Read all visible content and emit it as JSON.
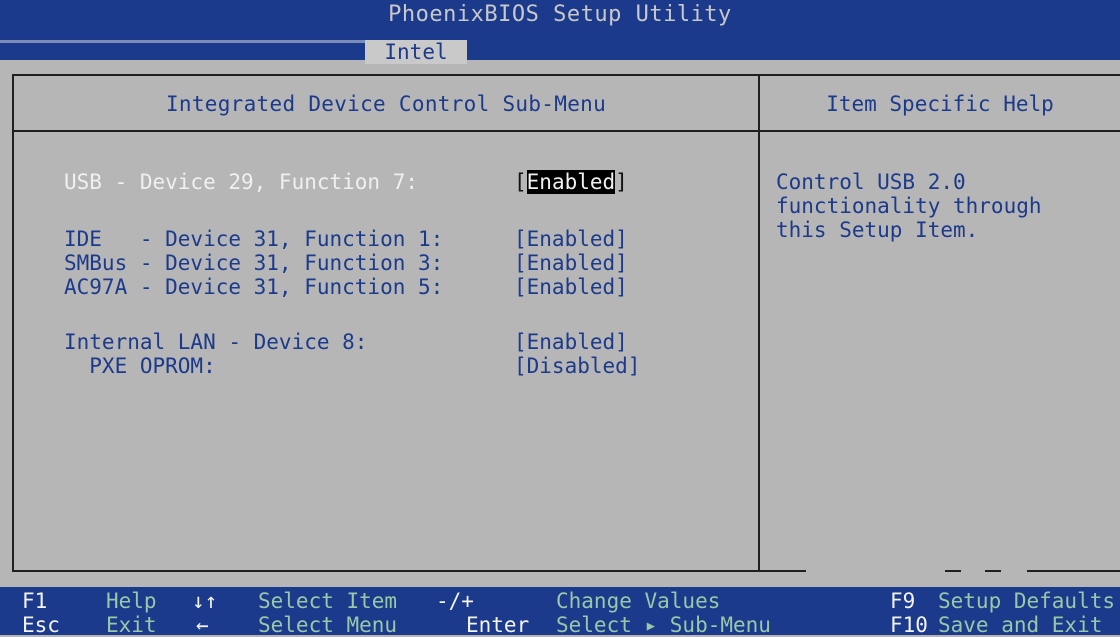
{
  "header": {
    "title": "PhoenixBIOS Setup Utility",
    "tab": "Intel"
  },
  "menu": {
    "title": "Integrated Device Control Sub-Menu",
    "items": [
      {
        "label": "USB - Device 29, Function 7:",
        "value_open": "[",
        "value": "Enabled",
        "value_close": "]",
        "selected": true
      },
      {
        "label": "IDE   - Device 31, Function 1:",
        "value": "[Enabled]"
      },
      {
        "label": "SMBus - Device 31, Function 3:",
        "value": "[Enabled]"
      },
      {
        "label": "AC97A - Device 31, Function 5:",
        "value": "[Enabled]"
      },
      {
        "label": "Internal LAN - Device 8:",
        "value": "[Enabled]"
      },
      {
        "label": "  PXE OPROM:",
        "value": "[Disabled]"
      }
    ]
  },
  "help": {
    "title": "Item Specific Help",
    "text": "Control USB 2.0\nfunctionality through\nthis Setup Item."
  },
  "footer": {
    "row1": [
      {
        "key": "F1",
        "desc": "Help"
      },
      {
        "key": "↓↑",
        "desc": "Select Item"
      },
      {
        "key": "-/+",
        "desc": "Change Values"
      },
      {
        "key": "F9",
        "desc": "Setup Defaults"
      }
    ],
    "row2": [
      {
        "key": "Esc",
        "desc": "Exit"
      },
      {
        "key": "←",
        "desc": "Select Menu"
      },
      {
        "key": "Enter",
        "desc": "Select ▸ Sub-Menu"
      },
      {
        "key": "F10",
        "desc": "Save and Exit"
      }
    ]
  },
  "colors": {
    "background": "#b6b6b6",
    "bar": "#1c3a8c",
    "text": "#1c3a8c",
    "selected_text": "#f0f0f0"
  }
}
